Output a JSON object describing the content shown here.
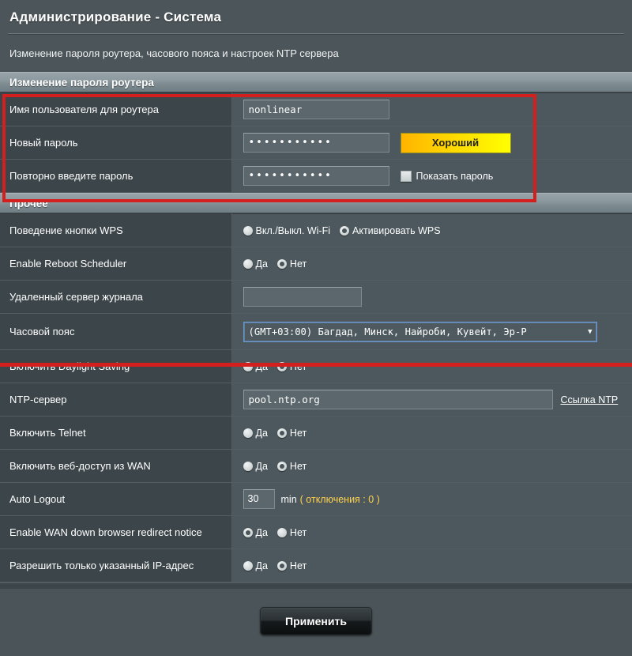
{
  "header": {
    "title": "Администрирование - Система",
    "subtitle": "Изменение пароля роутера, часового пояса и настроек NTP сервера"
  },
  "password_section": {
    "heading": "Изменение пароля роутера",
    "username": {
      "label": "Имя пользователя для роутера",
      "value": "nonlinear"
    },
    "new_password": {
      "label": "Новый пароль",
      "value": "•••••••••••",
      "strength_badge": "Хороший",
      "strength_color": "#ffd500"
    },
    "retype_password": {
      "label": "Повторно введите пароль",
      "value": "•••••••••••",
      "show_password_label": "Показать пароль",
      "show_password_checked": false
    }
  },
  "other_section": {
    "heading": "Прочее",
    "rows": [
      {
        "label": "Поведение кнопки WPS",
        "type": "radio",
        "options": [
          "Вкл./Выкл. Wi-Fi",
          "Активировать WPS"
        ],
        "selected": 1
      },
      {
        "label": "Enable Reboot Scheduler",
        "type": "radio",
        "options": [
          "Да",
          "Нет"
        ],
        "selected": 1
      },
      {
        "label": "Удаленный сервер журнала",
        "type": "text",
        "value": ""
      },
      {
        "label": "Часовой пояс",
        "type": "select",
        "value": "(GMT+03:00) Багдад, Минск, Найроби, Кувейт, Эр-Р"
      },
      {
        "label": "Включить Daylight Saving",
        "type": "radio",
        "options": [
          "Да",
          "Нет"
        ],
        "selected": 1
      },
      {
        "label": "NTP-сервер",
        "type": "text_link",
        "value": "pool.ntp.org",
        "link": "Ссылка NTP"
      },
      {
        "label": "Включить Telnet",
        "type": "radio",
        "options": [
          "Да",
          "Нет"
        ],
        "selected": 1
      },
      {
        "label": "Включить веб-доступ из WAN",
        "type": "radio",
        "options": [
          "Да",
          "Нет"
        ],
        "selected": 1
      },
      {
        "label": "Auto Logout",
        "type": "number",
        "value": "30",
        "unit": "min",
        "note": "( отключения : 0 )"
      },
      {
        "label": "Enable WAN down browser redirect notice",
        "type": "radio",
        "options": [
          "Да",
          "Нет"
        ],
        "selected": 0
      },
      {
        "label": "Разрешить только указанный IP-адрес",
        "type": "radio",
        "options": [
          "Да",
          "Нет"
        ],
        "selected": 1
      }
    ]
  },
  "footer": {
    "apply_label": "Применить"
  },
  "icons": {
    "dropdown_arrow": "▼"
  }
}
